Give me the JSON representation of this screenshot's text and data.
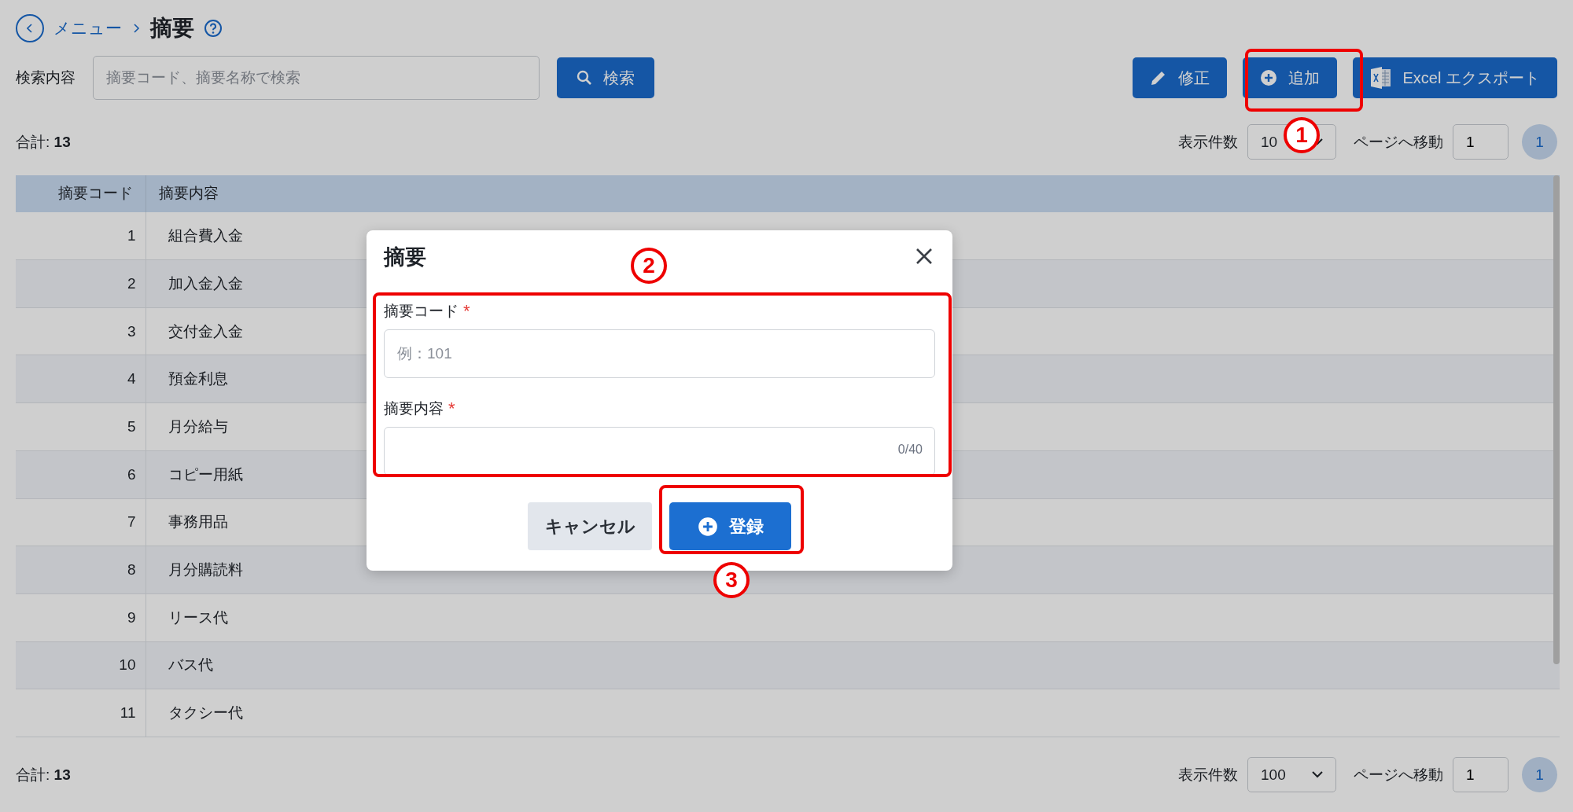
{
  "breadcrumb": {
    "parent": "メニュー",
    "title": "摘要"
  },
  "search": {
    "label": "検索内容",
    "placeholder": "摘要コード、摘要名称で検索",
    "button": "検索"
  },
  "actions": [
    {
      "kind": "edit",
      "label": "修正"
    },
    {
      "kind": "add",
      "label": "追加"
    },
    {
      "kind": "excel",
      "label": "Excel エクスポート"
    }
  ],
  "top_bar": {
    "total_label": "合計:",
    "total": "13",
    "page_size_label": "表示件数",
    "page_size": "10",
    "goto_label": "ページへ移動",
    "goto_value": "1",
    "pages": [
      {
        "label": "1",
        "selected": true
      }
    ]
  },
  "table": {
    "columns": [
      "摘要コード",
      "摘要内容"
    ],
    "rows": [
      [
        "1",
        "組合費入金"
      ],
      [
        "2",
        "加入金入金"
      ],
      [
        "3",
        "交付金入金"
      ],
      [
        "4",
        "預金利息"
      ],
      [
        "5",
        "月分給与"
      ],
      [
        "6",
        "コピー用紙"
      ],
      [
        "7",
        "事務用品"
      ],
      [
        "8",
        "月分購読料"
      ],
      [
        "9",
        "リース代"
      ],
      [
        "10",
        "バス代"
      ],
      [
        "11",
        "タクシー代"
      ]
    ]
  },
  "bottom_bar": {
    "total_label": "合計:",
    "total": "13",
    "page_size_label": "表示件数",
    "page_size": "100",
    "goto_label": "ページへ移動",
    "goto_value": "1",
    "pages": [
      {
        "label": "1",
        "selected": true
      }
    ]
  },
  "dialog": {
    "title": "摘要",
    "fields": [
      {
        "label": "摘要コード",
        "required": true,
        "required_mark": "*",
        "placeholder": "例：101"
      },
      {
        "label": "摘要内容",
        "required": true,
        "required_mark": "*",
        "counter": "0/40"
      }
    ],
    "buttons": [
      {
        "kind": "cancel",
        "label": "キャンセル"
      },
      {
        "kind": "submit",
        "label": "登録"
      }
    ]
  },
  "annotations": [
    {
      "label": "1"
    },
    {
      "label": "2"
    },
    {
      "label": "3"
    }
  ]
}
